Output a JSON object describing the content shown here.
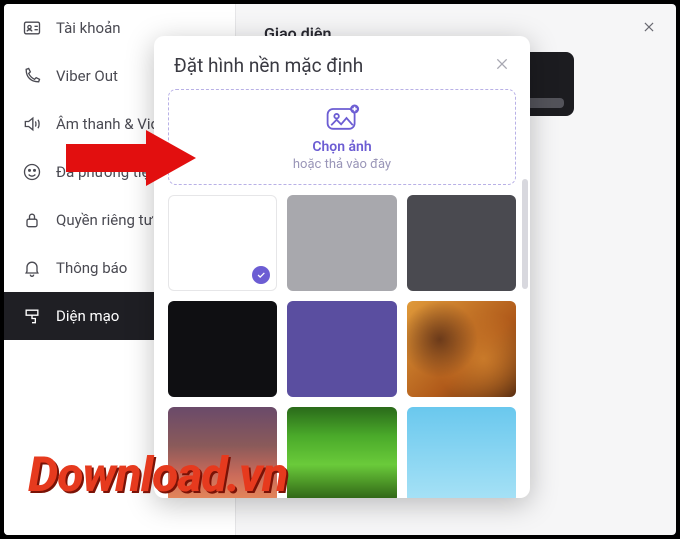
{
  "sidebar": {
    "items": [
      {
        "label": "Tài khoản"
      },
      {
        "label": "Viber Out"
      },
      {
        "label": "Âm thanh & Video"
      },
      {
        "label": "Đa phương tiện"
      },
      {
        "label": "Quyền riêng tư & Bảo mật"
      },
      {
        "label": "Thông báo"
      },
      {
        "label": "Diện mạo"
      }
    ]
  },
  "page": {
    "title": "Giao diện"
  },
  "modal": {
    "title": "Đặt hình nền mặc định",
    "dropzone_title": "Chọn ảnh",
    "dropzone_sub": "hoặc thả vào đây",
    "swatches": [
      {
        "name": "white",
        "selected": true
      },
      {
        "name": "light-gray",
        "color": "#a8a8ad"
      },
      {
        "name": "dark-gray",
        "color": "#4a4a50"
      },
      {
        "name": "almost-black",
        "color": "#0f0f12"
      },
      {
        "name": "purple",
        "color": "#5a4ea0"
      },
      {
        "name": "canyon-photo"
      },
      {
        "name": "dusk-photo"
      },
      {
        "name": "grass-photo"
      },
      {
        "name": "sky-photo"
      }
    ]
  },
  "watermark": "Download.vn"
}
